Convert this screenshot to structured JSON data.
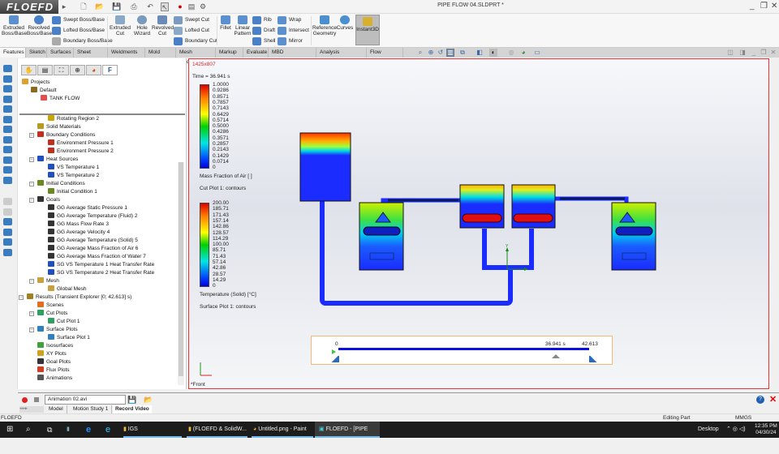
{
  "app": {
    "logo": "FLOEFD",
    "title": "PIPE FLOW 04.SLDPRT *"
  },
  "ribbon": {
    "large": [
      {
        "label": "Extruded Boss/Base"
      },
      {
        "label": "Revolved Boss/Base"
      },
      {
        "label": "Extruded Cut"
      },
      {
        "label": "Hole Wizard"
      },
      {
        "label": "Revolved Cut"
      },
      {
        "label": "Fillet"
      },
      {
        "label": "Linear Pattern"
      },
      {
        "label": "Reference Geometry"
      },
      {
        "label": "Curves"
      },
      {
        "label": "Instant3D"
      }
    ],
    "small": [
      {
        "label": "Swept Boss/Base"
      },
      {
        "label": "Lofted Boss/Base"
      },
      {
        "label": "Boundary Boss/Base"
      },
      {
        "label": "Swept Cut"
      },
      {
        "label": "Lofted Cut"
      },
      {
        "label": "Boundary Cut"
      },
      {
        "label": "Rib"
      },
      {
        "label": "Draft"
      },
      {
        "label": "Shell"
      },
      {
        "label": "Wrap"
      },
      {
        "label": "Intersect"
      },
      {
        "label": "Mirror"
      }
    ]
  },
  "tabs": [
    "Features",
    "Sketch",
    "Surfaces",
    "Sheet Metal",
    "Weldments",
    "Mold Tools",
    "Mesh Modeling",
    "Markup",
    "Evaluate",
    "MBD Dimensions",
    "Analysis Preparation",
    "Flow Analysis"
  ],
  "projects": {
    "root": "Projects",
    "config": "Default",
    "project": "TANK FLOW"
  },
  "tree": [
    {
      "label": "Rotating Region 2",
      "level": 2,
      "color": "#c8a800"
    },
    {
      "label": "Solid Materials",
      "level": 1,
      "color": "#b89a20"
    },
    {
      "label": "Boundary Conditions",
      "level": 1,
      "color": "#c03020",
      "exp": true
    },
    {
      "label": "Environment Pressure 1",
      "level": 2,
      "color": "#c03020"
    },
    {
      "label": "Environment Pressure 2",
      "level": 2,
      "color": "#c03020"
    },
    {
      "label": "Heat Sources",
      "level": 1,
      "color": "#2050c0",
      "exp": true
    },
    {
      "label": "VS Temperature 1",
      "level": 2,
      "color": "#2050c0"
    },
    {
      "label": "VS Temperature 2",
      "level": 2,
      "color": "#2050c0"
    },
    {
      "label": "Initial Conditions",
      "level": 1,
      "color": "#6a8a20",
      "exp": true
    },
    {
      "label": "Initial Condition 1",
      "level": 2,
      "color": "#6a8a20"
    },
    {
      "label": "Goals",
      "level": 1,
      "color": "#333",
      "exp": true
    },
    {
      "label": "GG Average Static Pressure 1",
      "level": 2,
      "color": "#333"
    },
    {
      "label": "GG Average Temperature (Fluid) 2",
      "level": 2,
      "color": "#333"
    },
    {
      "label": "GG Mass Flow Rate 3",
      "level": 2,
      "color": "#333"
    },
    {
      "label": "GG Average Velocity 4",
      "level": 2,
      "color": "#333"
    },
    {
      "label": "GG Average Temperature (Solid) 5",
      "level": 2,
      "color": "#333"
    },
    {
      "label": "GG Average Mass Fraction of Air 6",
      "level": 2,
      "color": "#333"
    },
    {
      "label": "GG Average Mass Fraction of Water 7",
      "level": 2,
      "color": "#333"
    },
    {
      "label": "SG VS Temperature 1 Heat Transfer Rate",
      "level": 2,
      "color": "#2050c0"
    },
    {
      "label": "SG VS Temperature 2 Heat Transfer Rate",
      "level": 2,
      "color": "#2050c0"
    },
    {
      "label": "Mesh",
      "level": 1,
      "color": "#c8a040",
      "exp": true
    },
    {
      "label": "Global Mesh",
      "level": 2,
      "color": "#c8a040"
    },
    {
      "label": "Results (Transient Explorer [0; 42.613] s)",
      "level": 0,
      "color": "#a08020",
      "exp": true
    },
    {
      "label": "Scenes",
      "level": 1,
      "color": "#e07020"
    },
    {
      "label": "Cut Plots",
      "level": 1,
      "color": "#30a060",
      "exp": true
    },
    {
      "label": "Cut Plot 1",
      "level": 2,
      "color": "#30a060"
    },
    {
      "label": "Surface Plots",
      "level": 1,
      "color": "#3080c0",
      "exp": true
    },
    {
      "label": "Surface Plot 1",
      "level": 2,
      "color": "#3080c0"
    },
    {
      "label": "Isosurfaces",
      "level": 1,
      "color": "#40a040"
    },
    {
      "label": "XY Plots",
      "level": 1,
      "color": "#d0a020"
    },
    {
      "label": "Goal Plots",
      "level": 1,
      "color": "#333"
    },
    {
      "label": "Flux Plots",
      "level": 1,
      "color": "#d04020"
    },
    {
      "label": "Animations",
      "level": 1,
      "color": "#555"
    }
  ],
  "viewport": {
    "resolution": "1425x807",
    "time": "Time = 36.941 s",
    "legend1": {
      "ticks": [
        "1.0000",
        "0.9286",
        "0.8571",
        "0.7857",
        "0.7143",
        "0.6429",
        "0.5714",
        "0.5000",
        "0.4286",
        "0.3571",
        "0.2857",
        "0.2143",
        "0.1429",
        "0.0714",
        "0"
      ],
      "title": "Mass Fraction of Air [ ]",
      "plot": "Cut Plot 1: contours"
    },
    "legend2": {
      "ticks": [
        "200.00",
        "185.71",
        "171.43",
        "157.14",
        "142.86",
        "128.57",
        "114.29",
        "100.00",
        "85.71",
        "71.43",
        "57.14",
        "42.86",
        "28.57",
        "14.29",
        "0"
      ],
      "title": "Temperature (Solid) [°C]",
      "plot": "Surface Plot 1: contours"
    },
    "view_label": "*Front",
    "axis": {
      "y": "Y",
      "x": "X"
    },
    "timeline": {
      "start": "0",
      "current": "36.941 s",
      "end": "42.613",
      "progress": 0.8669
    }
  },
  "animation": {
    "file": "Animation 02.avi"
  },
  "bottom_tabs": [
    "Model",
    "Motion Study 1",
    "Record Video"
  ],
  "status": {
    "left": "FLOEFD",
    "mode": "Editing Part",
    "units": "MMGS"
  },
  "taskbar": {
    "items": [
      "IGS",
      "(FLOEFD & SolidW...",
      "Untitled.png - Paint",
      "FLOEFD - [PIPE FLO..."
    ],
    "desktop": "Desktop",
    "time": "12:35 PM",
    "date": "04/30/24"
  }
}
